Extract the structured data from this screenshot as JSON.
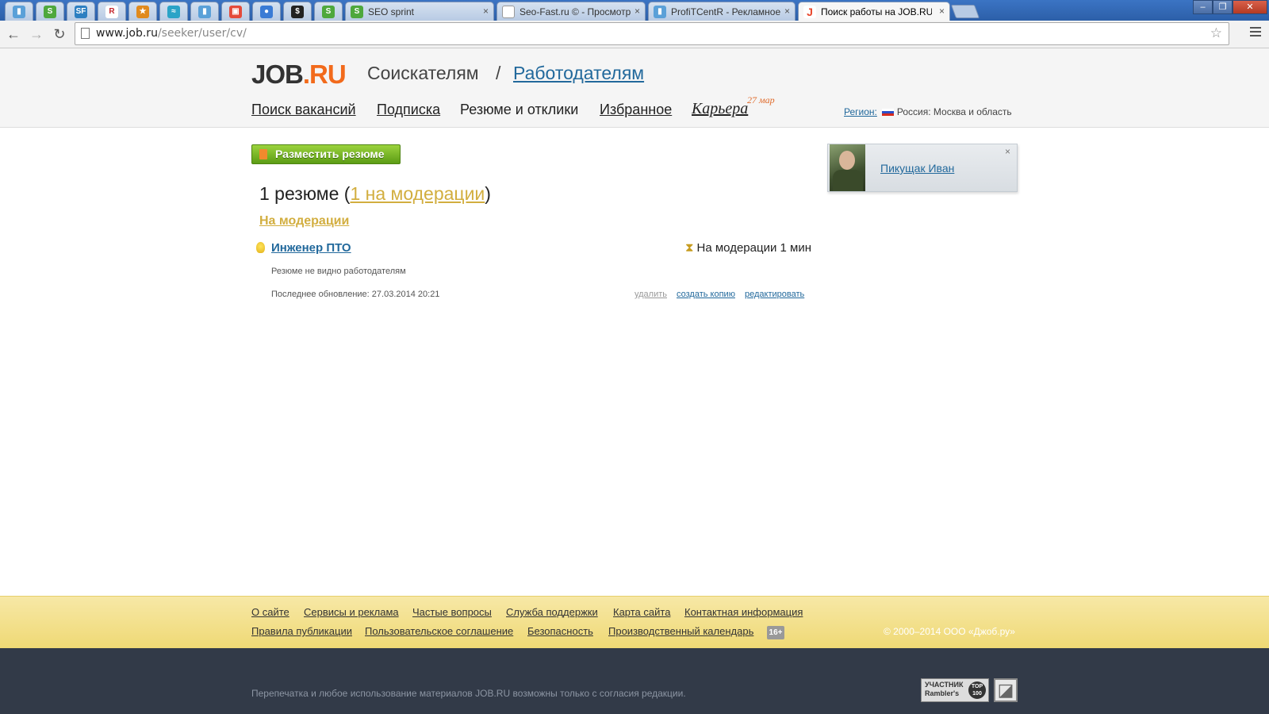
{
  "browser": {
    "tabs": [
      {
        "title": "SEO sprint",
        "active": false
      },
      {
        "title": "Seo-Fast.ru © - Просмотр",
        "active": false
      },
      {
        "title": "ProfiTCentR - Рекламное",
        "active": false
      },
      {
        "title": "Поиск работы на JOB.RU",
        "active": true
      }
    ],
    "close_glyph": "×",
    "url_host": "www.job.ru",
    "url_path": "/seeker/user/cv/",
    "window_buttons": {
      "minimize": "–",
      "maximize": "❐",
      "close": "✕"
    }
  },
  "header": {
    "logo_main": "JOB",
    "logo_dot": ".RU",
    "seekers": "Соискателям",
    "slash": "/",
    "employers": "Работодателям",
    "nav": {
      "vacancy_search": "Поиск вакансий",
      "subscription": "Подписка",
      "resumes": "Резюме и отклики",
      "favorites": "Избранное",
      "career": "Карьера",
      "career_date": "27 мар"
    },
    "region_label": "Регион:",
    "region_value": "Россия: Москва и область"
  },
  "main": {
    "post_button": "Разместить резюме",
    "count_prefix": "1 резюме (",
    "count_link": "1 на модерации",
    "count_suffix": ")",
    "section_title": "На модерации",
    "cv": {
      "title": "Инженер ПТО",
      "status": "На модерации 1 мин",
      "status_icon": "⧗",
      "hidden_note": "Резюме не видно работодателям",
      "updated": "Последнее обновление: 27.03.2014 20:21",
      "actions": {
        "delete": "удалить",
        "copy": "создать копию",
        "edit": "редактировать"
      }
    }
  },
  "user_card": {
    "name": "Пикущак Иван",
    "close": "×"
  },
  "footer": {
    "links_row1": [
      "О сайте",
      "Сервисы и реклама",
      "Частые вопросы",
      "Служба поддержки",
      "Карта сайта",
      "Контактная информация"
    ],
    "links_row2": [
      "Правила публикации",
      "Пользовательское соглашение",
      "Безопасность",
      "Производственный календарь"
    ],
    "age": "16+",
    "copyright": "© 2000–2014 ООО «Джоб.ру»",
    "reprint": "Перепечатка и любое использование материалов JOB.RU возможны только с согласия редакции.",
    "rambler_line1": "УЧАСТНИК",
    "rambler_line2": "Rambler's",
    "rambler_top": "TOP 100",
    "liveinternet": "◪"
  },
  "colors": {
    "accent_link": "#22699c",
    "moderation_yellow": "#d2ae3f",
    "logo_orange": "#f26a1b",
    "footer_yellow": "#efd975",
    "footer_dark": "#323a48"
  }
}
